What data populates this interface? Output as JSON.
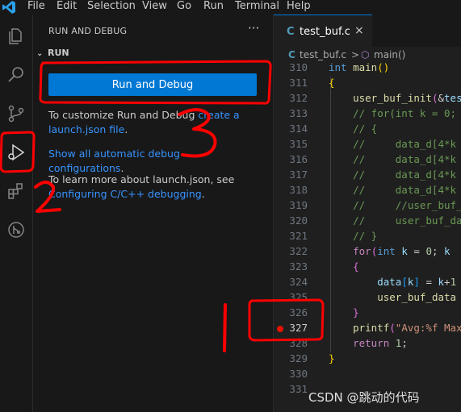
{
  "menu": [
    "File",
    "Edit",
    "Selection",
    "View",
    "Go",
    "Run",
    "Terminal",
    "Help"
  ],
  "activity_bar": [
    "explorer-icon",
    "search-icon",
    "source-control-icon",
    "run-debug-icon",
    "extensions-icon",
    "remote-explorer-icon"
  ],
  "sidebar": {
    "title": "RUN AND DEBUG",
    "more": "···",
    "section": "RUN",
    "run_button": "Run and Debug",
    "p1_text": "To customize Run and Debug ",
    "p1_link1": "create a",
    "p1_link2": "launch.json file",
    "p1_end": ".",
    "show_all_link": "Show all automatic debug configurations",
    "show_all_end": ".",
    "p3_text": "To learn more about launch.json, see",
    "p3_link": "Configuring C/C++ debugging",
    "p3_end": "."
  },
  "editor": {
    "tab_icon": "C",
    "tab_name": "test_buf.c",
    "tab_close": "×",
    "breadcrumb_file": "test_buf.c",
    "breadcrumb_sep": ">",
    "breadcrumb_symbol": "main()",
    "lines": [
      "310",
      "311",
      "312",
      "313",
      "314",
      "315",
      "316",
      "317",
      "318",
      "319",
      "320",
      "321",
      "322",
      "323",
      "324",
      "325",
      "326",
      "327",
      "328",
      "329",
      "330",
      "331"
    ],
    "breakpoint_line": "327"
  },
  "annotations": [
    "1",
    "2",
    "3"
  ],
  "watermark": "CSDN @跳动的代码",
  "colors": {
    "accent": "#0078d4",
    "link": "#3794ff",
    "breakpoint": "#e51400",
    "annotation": "#ff0000"
  }
}
